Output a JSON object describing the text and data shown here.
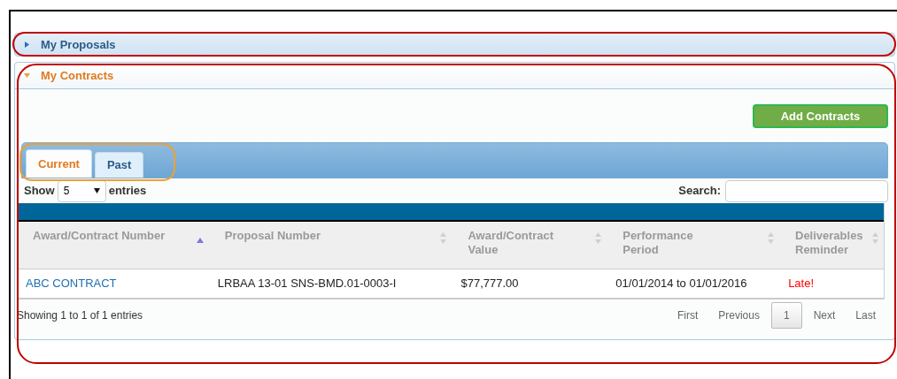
{
  "sections": [
    {
      "title": "My Proposals",
      "expanded": false
    },
    {
      "title": "My Contracts",
      "expanded": true
    }
  ],
  "add_button": "Add Contracts",
  "tabs": [
    {
      "label": "Current",
      "selected": true
    },
    {
      "label": "Past",
      "selected": false
    }
  ],
  "length": {
    "before": "Show",
    "value": "5",
    "after": "entries"
  },
  "search": {
    "label": "Search:"
  },
  "columns": [
    {
      "label": "Award/Contract Number",
      "sorted": true
    },
    {
      "label": "Proposal Number",
      "sorted": false
    },
    {
      "label": "Award/Contract Value",
      "sorted": false
    },
    {
      "label": "Performance Period",
      "sorted": false
    },
    {
      "label": "Deliverables Reminder",
      "sorted": false
    }
  ],
  "rows": [
    {
      "cells": [
        {
          "kind": "link",
          "text": "ABC CONTRACT"
        },
        {
          "kind": "text",
          "text": "LRBAA 13-01 SNS-BMD.01-0003-I"
        },
        {
          "kind": "text",
          "text": "$77,777.00"
        },
        {
          "kind": "text",
          "text": "01/01/2014 to 01/01/2016"
        },
        {
          "kind": "alert",
          "text": "Late!"
        }
      ]
    }
  ],
  "info": "Showing 1 to 1 of 1 entries",
  "pages": [
    {
      "label": "First",
      "selected": false
    },
    {
      "label": "Previous",
      "selected": false
    },
    {
      "label": "1",
      "selected": true
    },
    {
      "label": "Next",
      "selected": false
    },
    {
      "label": "Last",
      "selected": false
    }
  ],
  "annotations": [
    {
      "color": "#c00000"
    },
    {
      "color": "#c00000"
    },
    {
      "color": "#f0a030"
    }
  ]
}
